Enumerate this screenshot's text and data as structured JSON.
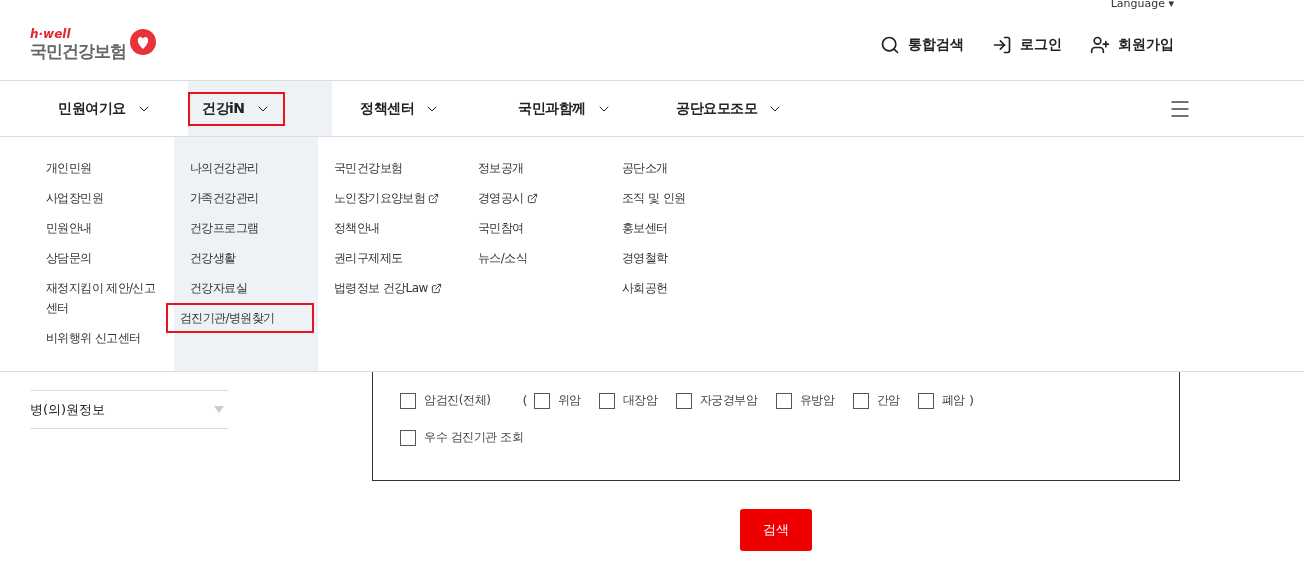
{
  "utility": {
    "language": "Language",
    "caret": "▾"
  },
  "logo": {
    "tagline": "h·well",
    "name": "국민건강보험"
  },
  "header_actions": [
    {
      "kind": "search",
      "label": "통합검색"
    },
    {
      "kind": "login",
      "label": "로그인"
    },
    {
      "kind": "join",
      "label": "회원가입"
    }
  ],
  "nav": [
    {
      "label": "민원여기요",
      "selected": false,
      "items": [
        {
          "label": "개인민원"
        },
        {
          "label": "사업장민원"
        },
        {
          "label": "민원안내"
        },
        {
          "label": "상담문의"
        },
        {
          "label": "재정지킴이 제안/신고센터"
        },
        {
          "label": "비위행위 신고센터"
        }
      ]
    },
    {
      "label": "건강iN",
      "selected": true,
      "items": [
        {
          "label": "나의건강관리"
        },
        {
          "label": "가족건강관리"
        },
        {
          "label": "건강프로그램"
        },
        {
          "label": "건강생활"
        },
        {
          "label": "건강자료실"
        },
        {
          "label": "검진기관/병원찾기",
          "selected": true
        }
      ]
    },
    {
      "label": "정책센터",
      "selected": false,
      "items": [
        {
          "label": "국민건강보험"
        },
        {
          "label": "노인장기요양보험",
          "external": true
        },
        {
          "label": "정책안내"
        },
        {
          "label": "권리구제제도"
        },
        {
          "label": "법령정보 건강Law",
          "external": true
        }
      ]
    },
    {
      "label": "국민과함께",
      "selected": false,
      "items": [
        {
          "label": "정보공개"
        },
        {
          "label": "경영공시",
          "external": true
        },
        {
          "label": "국민참여"
        },
        {
          "label": "뉴스/소식"
        }
      ]
    },
    {
      "label": "공단요모조모",
      "selected": false,
      "items": [
        {
          "label": "공단소개"
        },
        {
          "label": "조직 및 인원"
        },
        {
          "label": "홍보센터"
        },
        {
          "label": "경영철학"
        },
        {
          "label": "사회공헌"
        }
      ]
    }
  ],
  "sidebar": {
    "items": [
      {
        "label": "병(의)원정보"
      }
    ]
  },
  "filters": {
    "all": {
      "label": "암검진(전체)",
      "checked": false
    },
    "open": "(",
    "close": ")",
    "items": [
      {
        "label": "위암",
        "checked": false
      },
      {
        "label": "대장암",
        "checked": false
      },
      {
        "label": "자궁경부암",
        "checked": false
      },
      {
        "label": "유방암",
        "checked": false
      },
      {
        "label": "간암",
        "checked": false
      },
      {
        "label": "폐암",
        "checked": false
      }
    ],
    "excellent": {
      "label": "우수 검진기관 조회",
      "checked": false
    }
  },
  "search_button": "검색"
}
